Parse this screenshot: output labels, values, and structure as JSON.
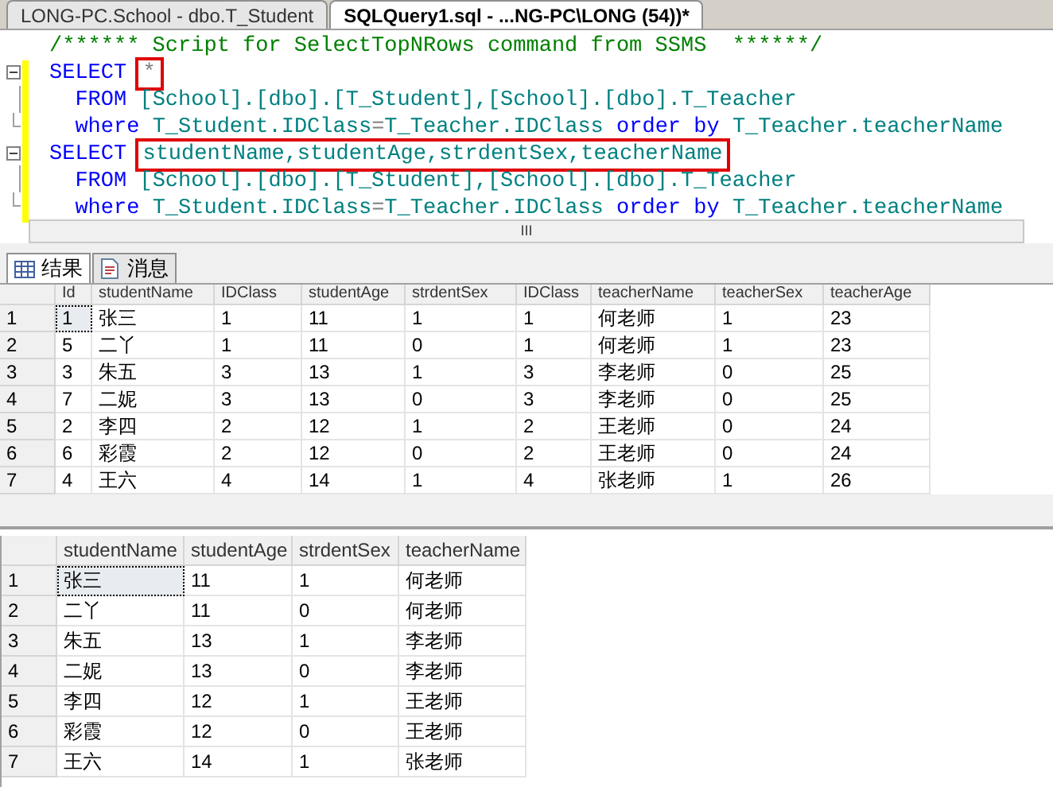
{
  "doc_tabs": [
    {
      "label": "LONG-PC.School - dbo.T_Student",
      "selected": false
    },
    {
      "label": "SQLQuery1.sql - ...NG-PC\\LONG (54))*",
      "selected": true
    }
  ],
  "editor": {
    "lines": [
      {
        "kind": "plain",
        "tokens": [
          {
            "kind": "comment",
            "text": "/****** Script for SelectTopNRows command from SSMS  ******/",
            "highlighted": false
          }
        ]
      },
      {
        "kind": "fold-start",
        "tokens": [
          {
            "kind": "keyword",
            "text": "SELECT",
            "highlighted": false
          },
          {
            "kind": "operator",
            "text": "*",
            "highlighted": true
          }
        ]
      },
      {
        "kind": "fold-mid",
        "tokens": [
          {
            "kind": "keyword",
            "text": "  FROM",
            "highlighted": false
          },
          {
            "kind": "ident",
            "text": "[School].[dbo].[T_Student],[School].[dbo].T_Teacher",
            "highlighted": false
          }
        ]
      },
      {
        "kind": "fold-end",
        "tokens": [
          {
            "kind": "keyword",
            "text": "  where",
            "highlighted": false
          },
          {
            "kind": "ident",
            "text": "T_Student.IDClass",
            "highlighted": false
          },
          {
            "kind": "operator",
            "text": "=",
            "highlighted": false
          },
          {
            "kind": "ident",
            "text": "T_Teacher.IDClass",
            "highlighted": false
          },
          {
            "kind": "keyword",
            "text": "order by",
            "highlighted": false
          },
          {
            "kind": "ident",
            "text": "T_Teacher.teacherName",
            "highlighted": false
          }
        ]
      },
      {
        "kind": "fold-start",
        "tokens": [
          {
            "kind": "keyword",
            "text": "SELECT",
            "highlighted": false
          },
          {
            "kind": "ident",
            "text": "studentName,studentAge,strdentSex,teacherName",
            "highlighted": true
          }
        ]
      },
      {
        "kind": "fold-mid",
        "tokens": [
          {
            "kind": "keyword",
            "text": "  FROM",
            "highlighted": false
          },
          {
            "kind": "ident",
            "text": "[School].[dbo].[T_Student],[School].[dbo].T_Teacher",
            "highlighted": false
          }
        ]
      },
      {
        "kind": "fold-end",
        "tokens": [
          {
            "kind": "keyword",
            "text": "  where",
            "highlighted": false
          },
          {
            "kind": "ident",
            "text": "T_Student.IDClass",
            "highlighted": false
          },
          {
            "kind": "operator",
            "text": "=",
            "highlighted": false
          },
          {
            "kind": "ident",
            "text": "T_Teacher.IDClass",
            "highlighted": false
          },
          {
            "kind": "keyword",
            "text": "order by",
            "highlighted": false
          },
          {
            "kind": "ident",
            "text": "T_Teacher.teacherName",
            "highlighted": false
          }
        ]
      }
    ]
  },
  "scroll_button": "III",
  "result_tabs": [
    {
      "label": "结果",
      "kind": "grid",
      "selected": true
    },
    {
      "label": "消息",
      "kind": "messages",
      "selected": false
    }
  ],
  "grids": [
    {
      "columns": [
        "Id",
        "studentName",
        "IDClass",
        "studentAge",
        "strdentSex",
        "IDClass",
        "teacherName",
        "teacherSex",
        "teacherAge"
      ],
      "rows": [
        {
          "num": "1",
          "cells": [
            "1",
            "张三",
            "1",
            "11",
            "1",
            "1",
            "何老师",
            "1",
            "23"
          ]
        },
        {
          "num": "2",
          "cells": [
            "5",
            "二丫",
            "1",
            "11",
            "0",
            "1",
            "何老师",
            "1",
            "23"
          ]
        },
        {
          "num": "3",
          "cells": [
            "3",
            "朱五",
            "3",
            "13",
            "1",
            "3",
            "李老师",
            "0",
            "25"
          ]
        },
        {
          "num": "4",
          "cells": [
            "7",
            "二妮",
            "3",
            "13",
            "0",
            "3",
            "李老师",
            "0",
            "25"
          ]
        },
        {
          "num": "5",
          "cells": [
            "2",
            "李四",
            "2",
            "12",
            "1",
            "2",
            "王老师",
            "0",
            "24"
          ]
        },
        {
          "num": "6",
          "cells": [
            "6",
            "彩霞",
            "2",
            "12",
            "0",
            "2",
            "王老师",
            "0",
            "24"
          ]
        },
        {
          "num": "7",
          "cells": [
            "4",
            "王六",
            "4",
            "14",
            "1",
            "4",
            "张老师",
            "1",
            "26"
          ]
        }
      ]
    },
    {
      "columns": [
        "studentName",
        "studentAge",
        "strdentSex",
        "teacherName"
      ],
      "rows": [
        {
          "num": "1",
          "cells": [
            "张三",
            "11",
            "1",
            "何老师"
          ]
        },
        {
          "num": "2",
          "cells": [
            "二丫",
            "11",
            "0",
            "何老师"
          ]
        },
        {
          "num": "3",
          "cells": [
            "朱五",
            "13",
            "1",
            "李老师"
          ]
        },
        {
          "num": "4",
          "cells": [
            "二妮",
            "13",
            "0",
            "李老师"
          ]
        },
        {
          "num": "5",
          "cells": [
            "李四",
            "12",
            "1",
            "王老师"
          ]
        },
        {
          "num": "6",
          "cells": [
            "彩霞",
            "12",
            "0",
            "王老师"
          ]
        },
        {
          "num": "7",
          "cells": [
            "王六",
            "14",
            "1",
            "张老师"
          ]
        }
      ]
    }
  ]
}
